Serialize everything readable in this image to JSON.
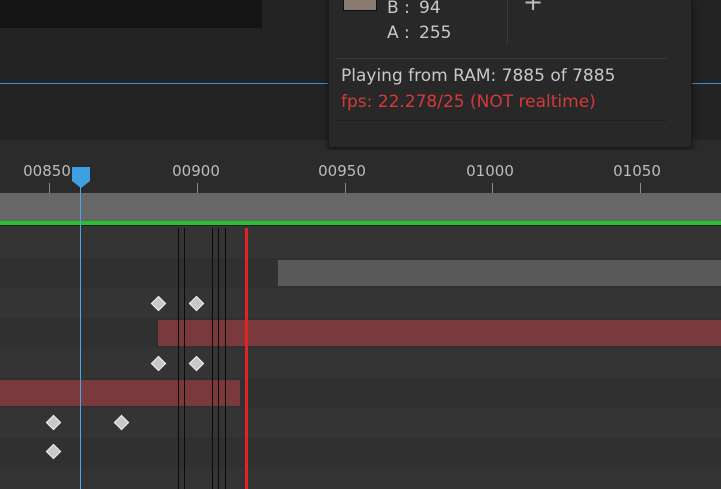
{
  "info": {
    "b_label": "B :",
    "b_value": "94",
    "a_label": "A :",
    "a_value": "255",
    "plus": "+",
    "playing": "Playing from RAM: 7885 of 7885",
    "fps": "fps: 22.278/25 (NOT realtime)",
    "swatch_color": "#8a7b72",
    "fps_color": "#d43a3a"
  },
  "ruler": {
    "labels": [
      "00850",
      "00900",
      "00950",
      "01000",
      "01050"
    ]
  },
  "colors": {
    "playhead": "#3f9fe0",
    "current_time": "#e02323",
    "work_area_bar": "#676767",
    "cache_bar": "#22c32b",
    "layer_bar_red": "#7a3a3d",
    "layer_bar_gray": "#595959"
  },
  "icons": [
    "keyframe-diamond-icon",
    "plus-icon",
    "playhead-marker-icon"
  ]
}
